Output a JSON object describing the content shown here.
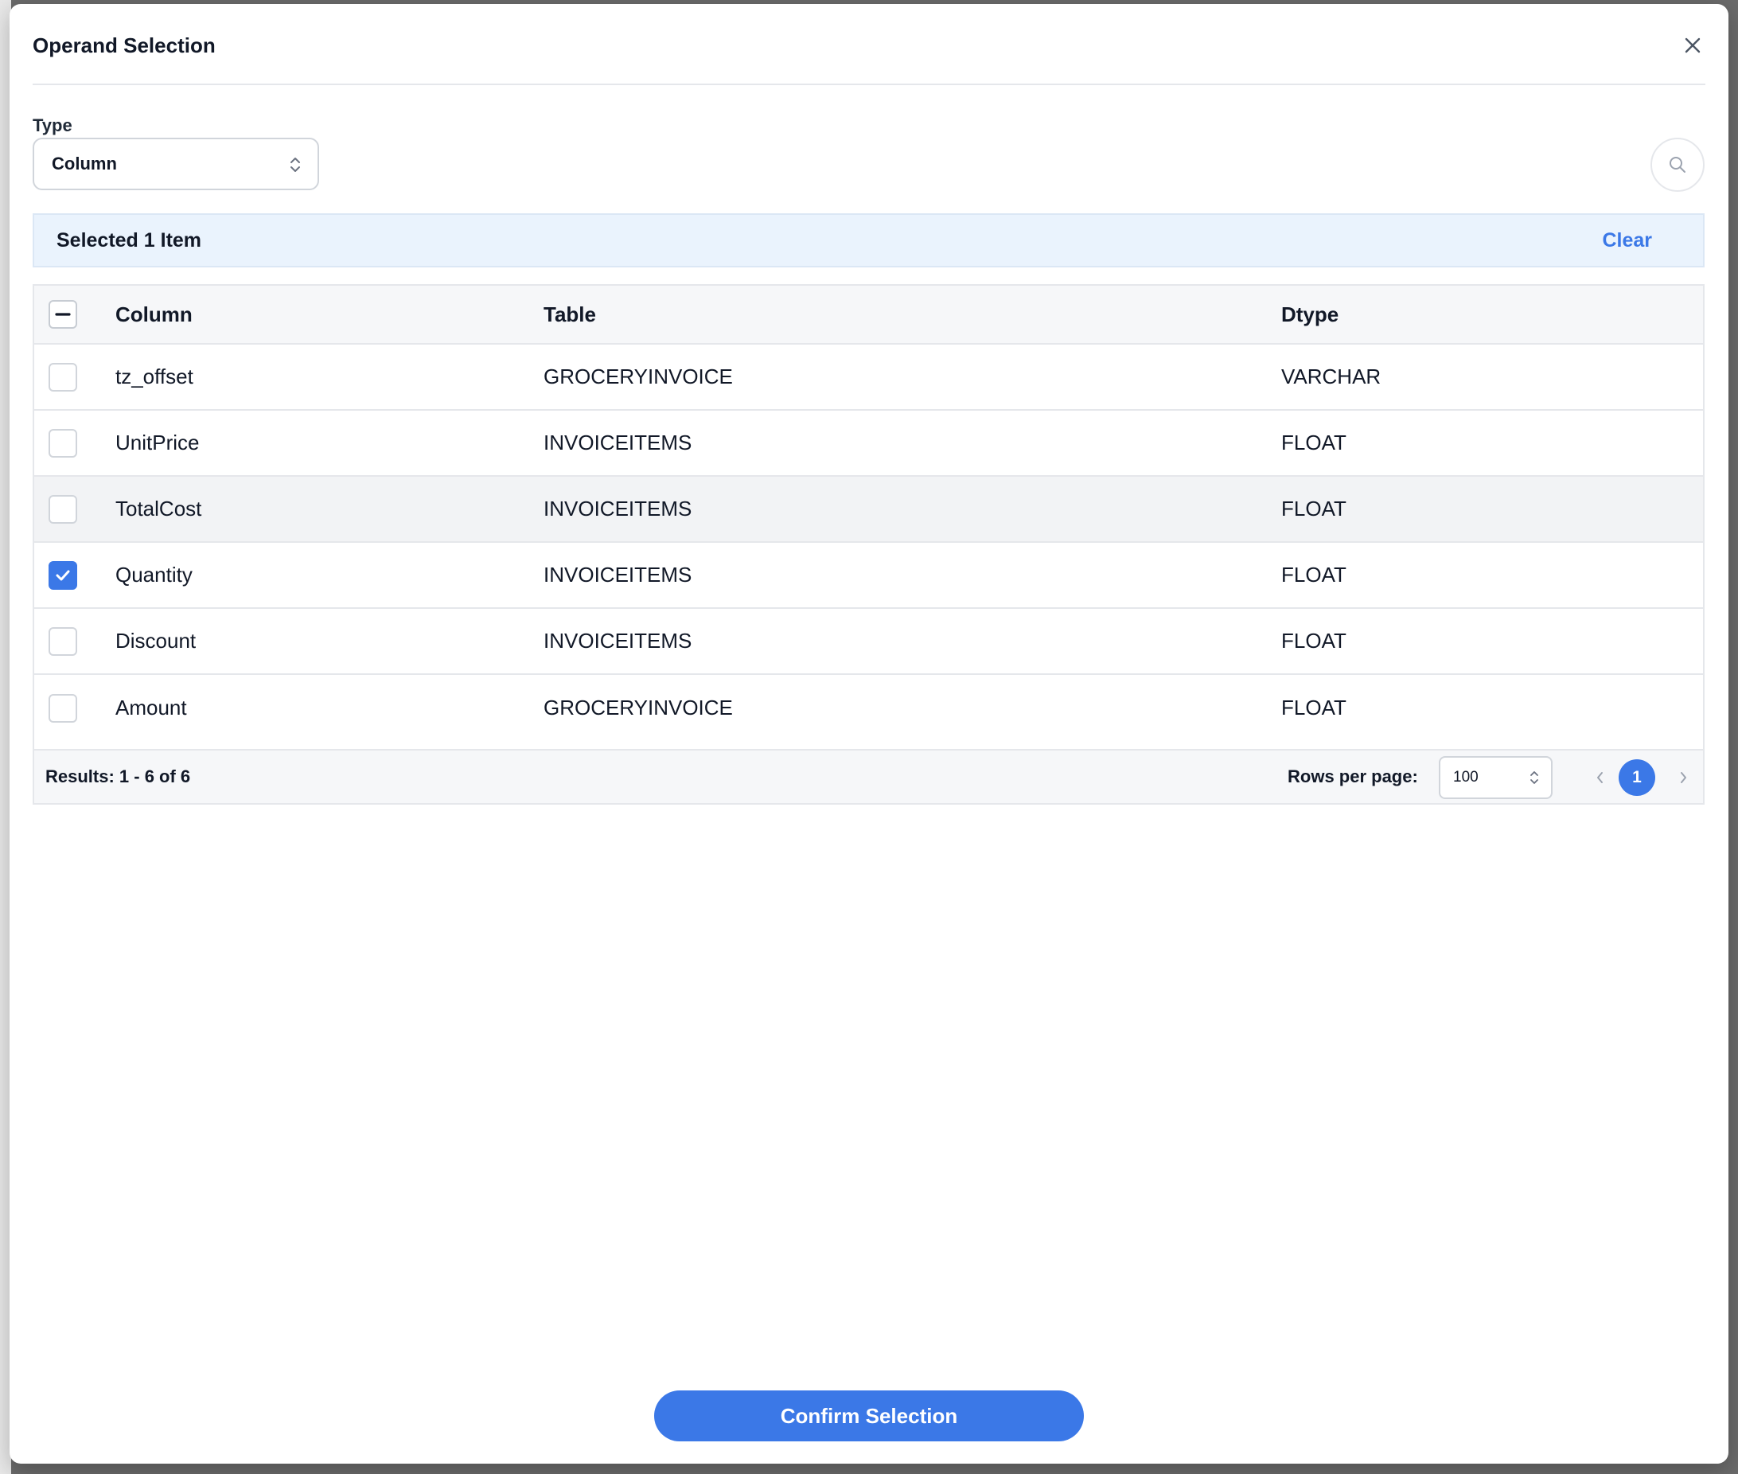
{
  "modal": {
    "title": "Operand Selection",
    "type_label": "Type",
    "type_value": "Column"
  },
  "selection": {
    "text": "Selected 1 Item",
    "clear_label": "Clear"
  },
  "table": {
    "headers": {
      "column": "Column",
      "table": "Table",
      "dtype": "Dtype"
    },
    "rows": [
      {
        "column": "tz_offset",
        "table": "GROCERYINVOICE",
        "dtype": "VARCHAR",
        "checked": false
      },
      {
        "column": "UnitPrice",
        "table": "INVOICEITEMS",
        "dtype": "FLOAT",
        "checked": false
      },
      {
        "column": "TotalCost",
        "table": "INVOICEITEMS",
        "dtype": "FLOAT",
        "checked": false
      },
      {
        "column": "Quantity",
        "table": "INVOICEITEMS",
        "dtype": "FLOAT",
        "checked": true
      },
      {
        "column": "Discount",
        "table": "INVOICEITEMS",
        "dtype": "FLOAT",
        "checked": false
      },
      {
        "column": "Amount",
        "table": "GROCERYINVOICE",
        "dtype": "FLOAT",
        "checked": false
      }
    ]
  },
  "footer": {
    "results": "Results: 1 - 6 of 6",
    "rows_per_page_label": "Rows per page:",
    "rows_per_page_value": "100",
    "current_page": "1"
  },
  "actions": {
    "confirm_label": "Confirm Selection"
  },
  "colors": {
    "accent": "#3b78e7",
    "selected_bar_bg": "#eaf3fd"
  }
}
